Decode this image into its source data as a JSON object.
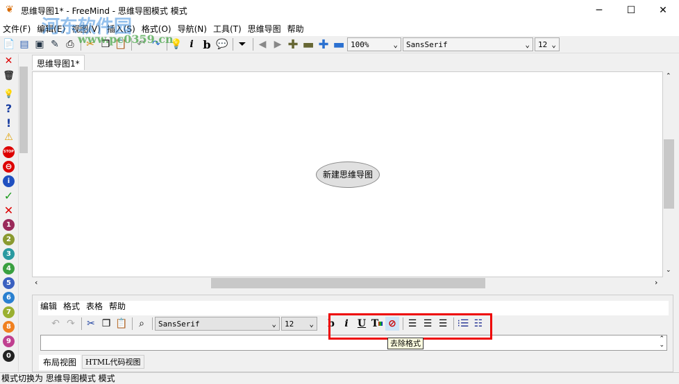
{
  "window": {
    "title": "思维导图1* - FreeMind - 思维导图模式 模式",
    "minimize": "─",
    "maximize": "☐",
    "close": "✕"
  },
  "menu": [
    "文件(F)",
    "编辑(E)",
    "视图(V)",
    "插入(S)",
    "格式(O)",
    "导航(N)",
    "工具(T)",
    "思维导图",
    "帮助"
  ],
  "toolbar": {
    "zoom": "100%",
    "font": "SansSerif",
    "size": "12"
  },
  "watermark": {
    "text": "河东软件园",
    "url": "www.pc0359.cn"
  },
  "tabs": [
    "思维导图1*"
  ],
  "map": {
    "root_node": "新建思维导图"
  },
  "left_icons": [
    "✕",
    "🗑",
    "💡",
    "?",
    "!",
    "⚠",
    "STOP",
    "⊖",
    "i",
    "✓",
    "✕",
    "1",
    "2",
    "3",
    "4",
    "5",
    "6",
    "7",
    "8",
    "9",
    "0"
  ],
  "editor": {
    "menu": [
      "编辑",
      "格式",
      "表格",
      "帮助"
    ],
    "font": "SansSerif",
    "size": "12",
    "tooltip": "去除格式",
    "view_tabs": [
      "布局视图",
      "HTML代码视图"
    ]
  },
  "status": "模式切换为 思维导图模式 模式",
  "colors": {
    "highlight": "#e00000"
  }
}
